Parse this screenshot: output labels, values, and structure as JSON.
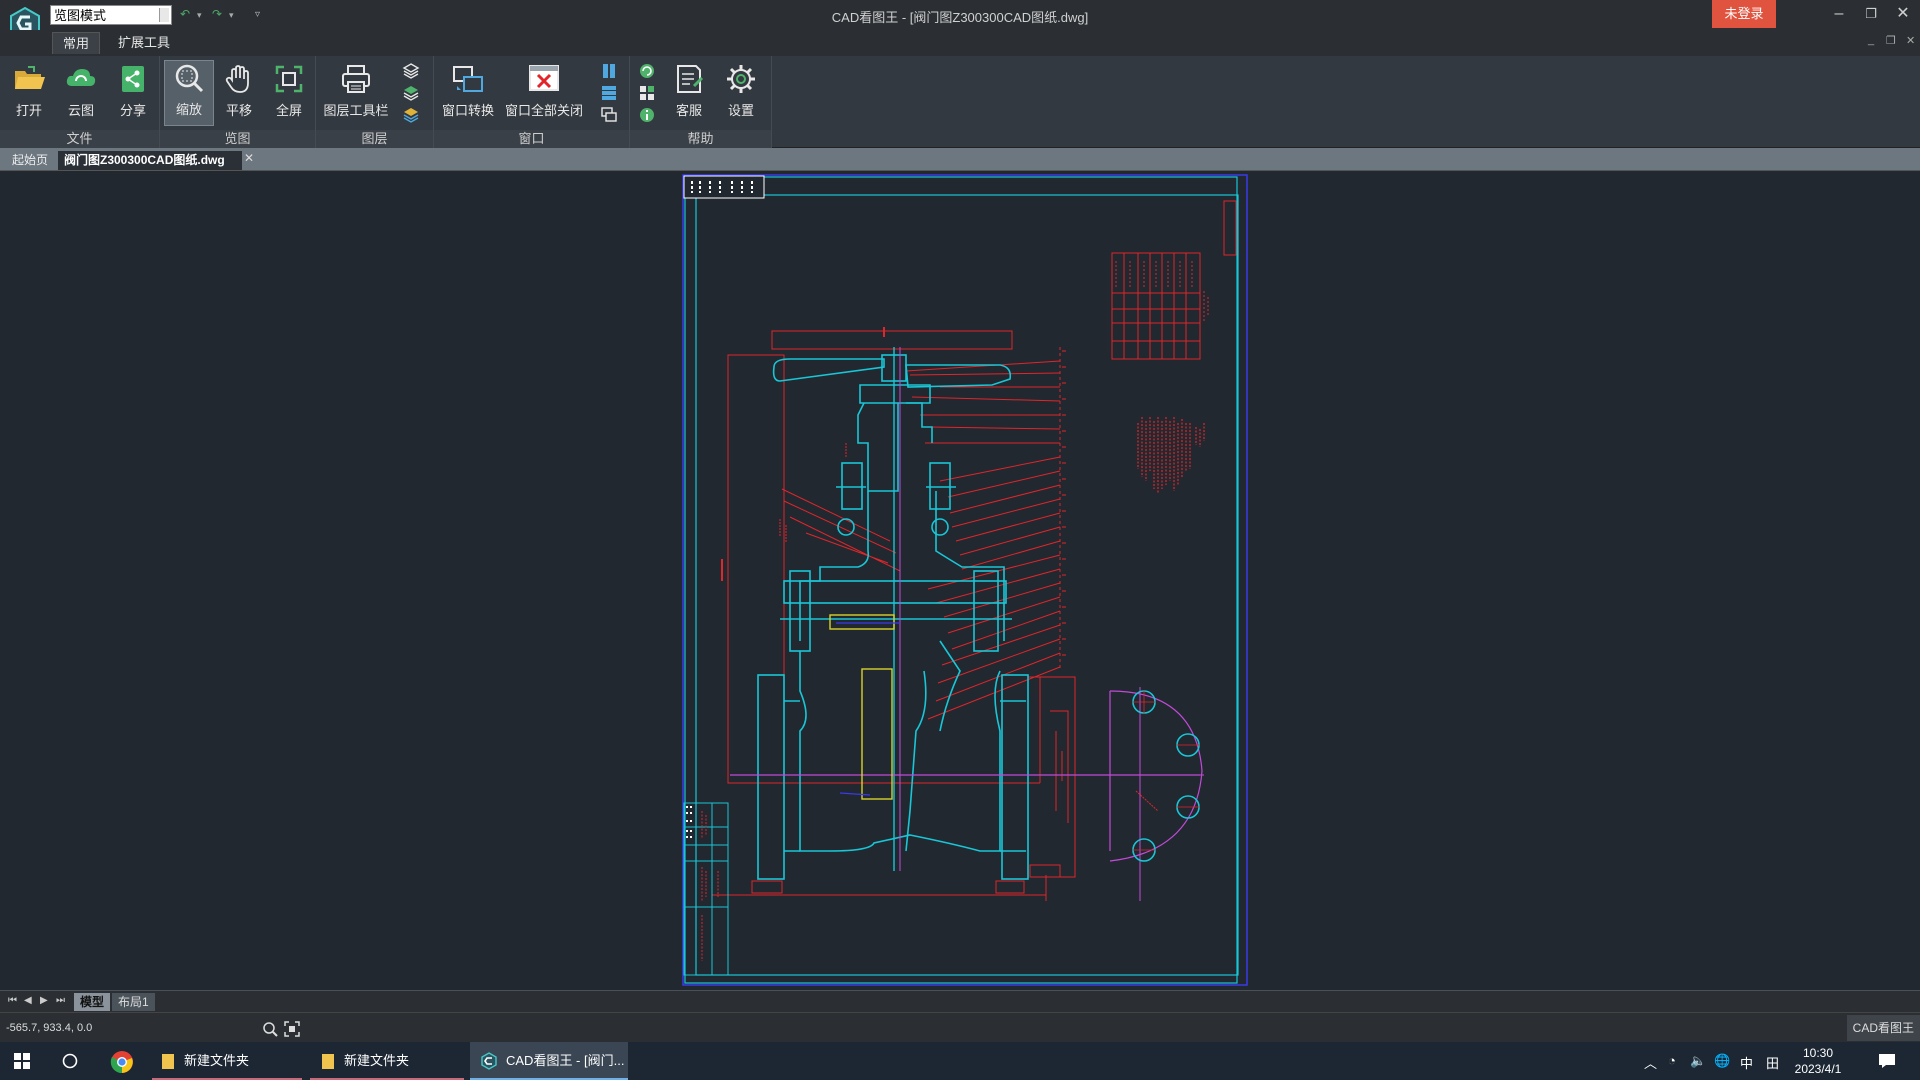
{
  "titlebar": {
    "mode_select": "览图模式",
    "window_title": "CAD看图王 - [阀门图Z300300CAD图纸.dwg]",
    "login_button": "未登录"
  },
  "ribbon_tabs": [
    "常用",
    "扩展工具"
  ],
  "ribbon": {
    "groups": {
      "file": "文件",
      "view": "览图",
      "layer": "图层",
      "window": "窗口",
      "help": "帮助"
    },
    "buttons": {
      "open": "打开",
      "cloud": "云图",
      "share": "分享",
      "zoom": "缩放",
      "pan": "平移",
      "fullscreen": "全屏",
      "layer_toolbar": "图层工具栏",
      "window_switch": "窗口转换",
      "close_all": "窗口全部关闭",
      "service": "客服",
      "settings": "设置"
    }
  },
  "doc_tabs": {
    "start": "起始页",
    "file": "阀门图Z300300CAD图纸.dwg"
  },
  "layout_tabs": [
    "模型",
    "布局1"
  ],
  "status": {
    "coords": "-565.7, 933.4, 0.0",
    "app_name": "CAD看图王"
  },
  "taskbar": {
    "items": [
      "新建文件夹",
      "新建文件夹",
      "CAD看图王 - [阀门..."
    ],
    "ime": "中",
    "time": "10:30",
    "date": "2023/4/1"
  },
  "colors": {
    "drawing_cyan": "#19c6d6",
    "drawing_red": "#e0262a",
    "drawing_magenta": "#c24ad8",
    "drawing_yellow": "#d8d22c",
    "drawing_blue": "#3a3ae8",
    "login_red": "#e0533e"
  }
}
